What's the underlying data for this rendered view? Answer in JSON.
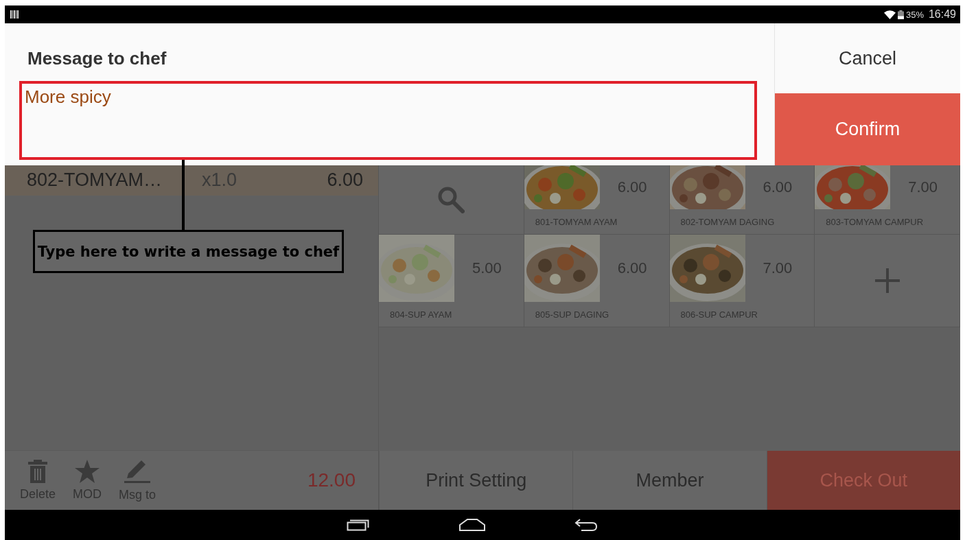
{
  "status_bar": {
    "battery": "35%",
    "time": "16:49"
  },
  "dialog": {
    "title": "Message to chef",
    "message": {
      "value": "More spicy"
    },
    "buttons": [
      {
        "label": "Cancel",
        "kind": "plain"
      },
      {
        "label": "Confirm",
        "kind": "primary"
      }
    ]
  },
  "annotation": {
    "text": "Type here to write a message to chef"
  },
  "order": {
    "items": [
      {
        "name": "802-TOMYAM…",
        "qty": "x1.0",
        "price": "6.00",
        "selected": true
      }
    ],
    "actions": [
      {
        "label": "Delete",
        "kind": "delete"
      },
      {
        "label": "MOD",
        "kind": "mod"
      },
      {
        "label": "Msg to",
        "kind": "message"
      }
    ],
    "total": "12.00"
  },
  "menu": {
    "tiles": [
      {
        "kind": "search"
      },
      {
        "kind": "dish",
        "name": "801-TOMYAM AYAM",
        "price": "6.00"
      },
      {
        "kind": "dish",
        "name": "802-TOMYAM DAGING",
        "price": "6.00"
      },
      {
        "kind": "dish",
        "name": "803-TOMYAM CAMPUR",
        "price": "7.00"
      },
      {
        "kind": "dish",
        "name": "804-SUP AYAM",
        "price": "5.00"
      },
      {
        "kind": "dish",
        "name": "805-SUP DAGING",
        "price": "6.00"
      },
      {
        "kind": "dish",
        "name": "806-SUP CAMPUR",
        "price": "7.00"
      },
      {
        "kind": "add"
      }
    ]
  },
  "bottom_buttons": [
    {
      "label": "Print Setting",
      "kind": "plain"
    },
    {
      "label": "Member",
      "kind": "plain"
    },
    {
      "label": "Check Out",
      "kind": "primary"
    }
  ]
}
